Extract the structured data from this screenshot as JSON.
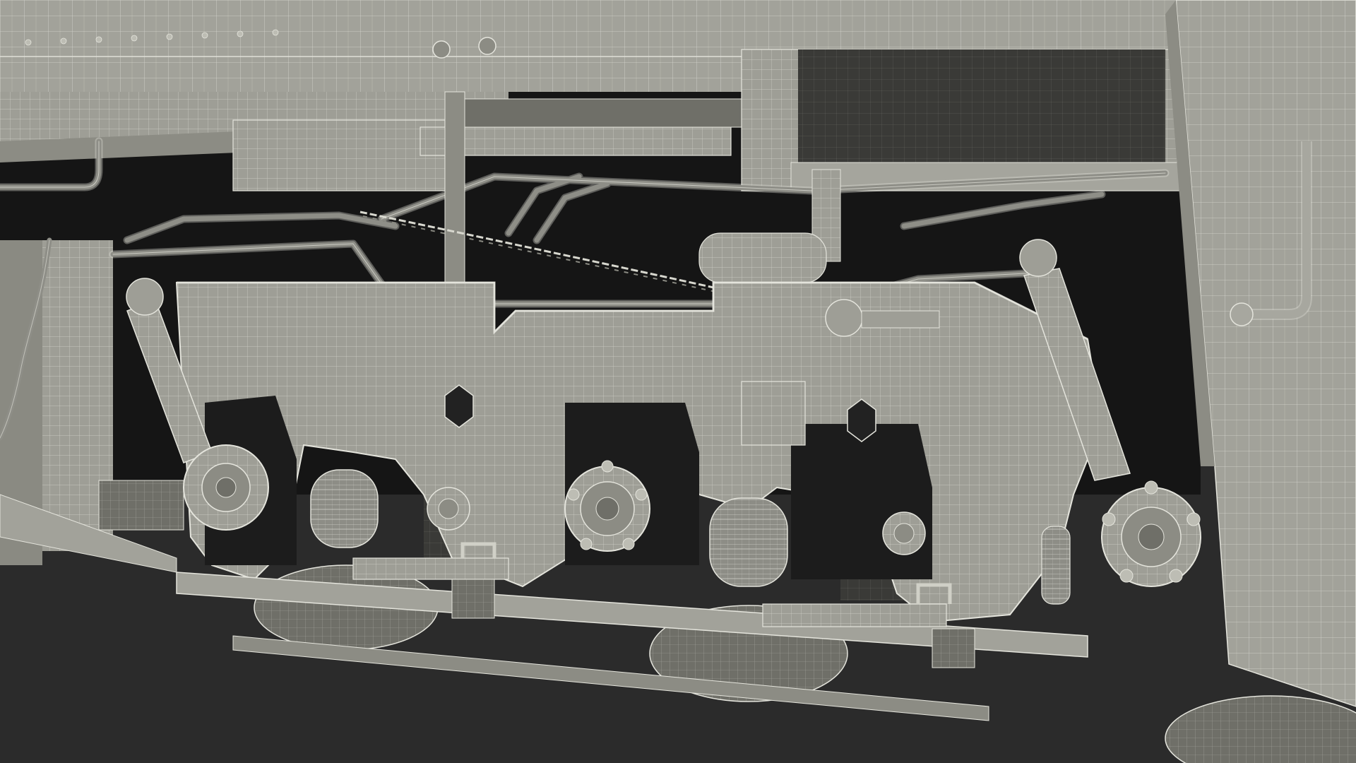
{
  "scene": {
    "colors": {
      "background": "#2b2b2b",
      "shadow": "#141414",
      "surface": "#9e9e96",
      "surface_light": "#b3b3aa",
      "surface_dark": "#6f6f68",
      "wire": "#e4e4dc"
    }
  }
}
